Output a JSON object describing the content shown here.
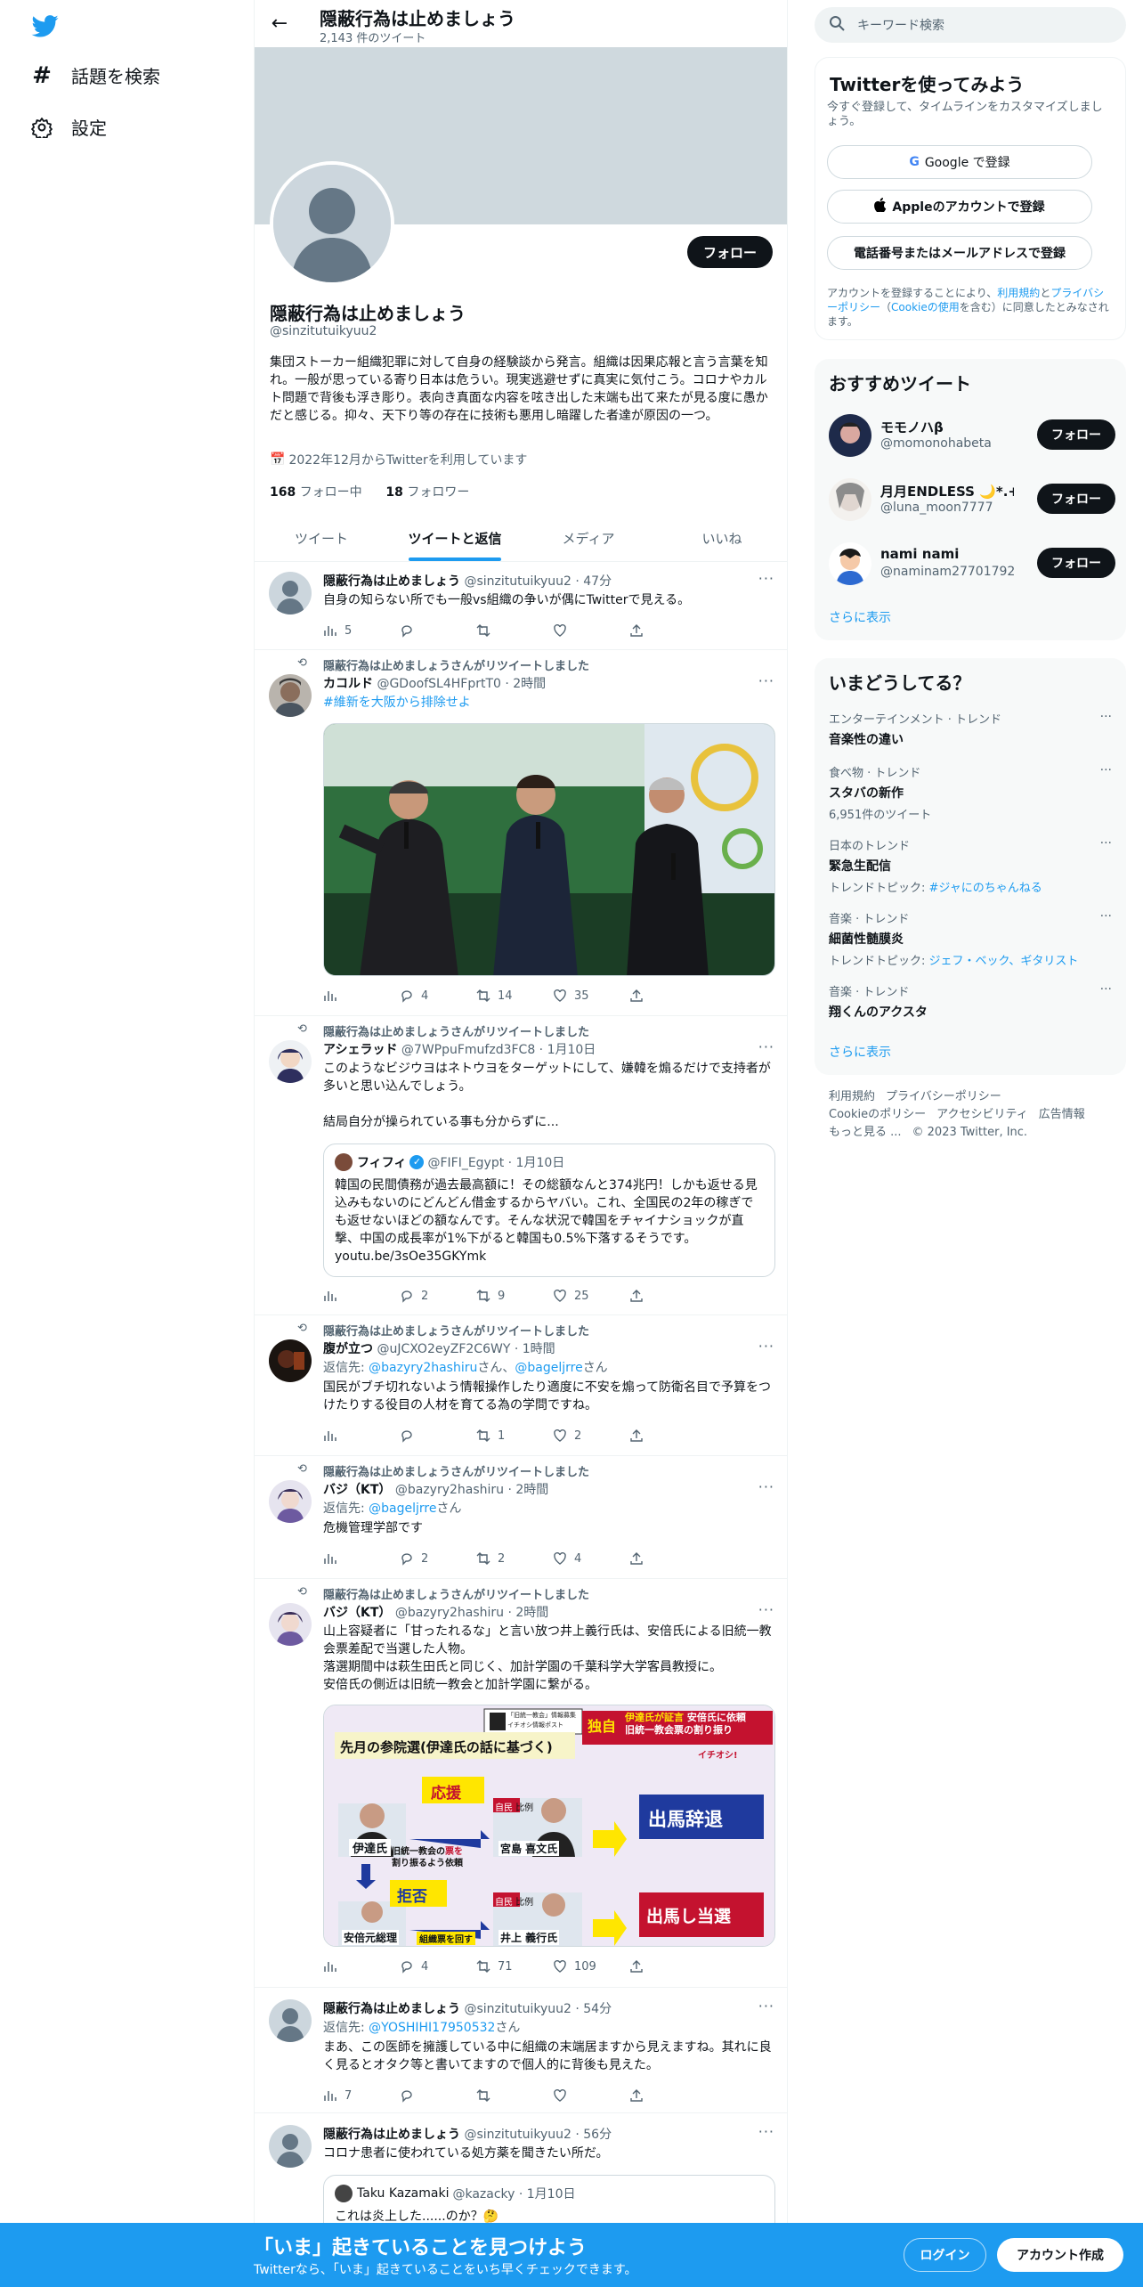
{
  "nav": {
    "explore": "話題を検索",
    "settings": "設定"
  },
  "header": {
    "name": "隠蔽行為は止めましょう",
    "tweet_count": "2,143 件のツイート"
  },
  "profile": {
    "follow_label": "フォロー",
    "name": "隠蔽行為は止めましょう",
    "handle": "@sinzitutuikyuu2",
    "bio": "集団ストーカー組織犯罪に対して自身の経験談から発言。組織は因果応報と言う言葉を知れ。一般が思っている寄り日本は危うい。現実逃避せずに真実に気付こう。コロナやカルト問題で背後も浮き彫り。表向き真面な内容を呟き出した末端も出て来たが見る度に愚かだと感じる。抑々、天下り等の存在に技術も悪用し暗躍した者達が原因の一つ。",
    "joined": "2022年12月からTwitterを利用しています",
    "following_count": "168",
    "following_label": "フォロー中",
    "followers_count": "18",
    "followers_label": "フォロワー"
  },
  "tabs": [
    "ツイート",
    "ツイートと返信",
    "メディア",
    "いいね"
  ],
  "tweets": [
    {
      "name": "隠蔽行為は止めましょう",
      "meta": "@sinzitutuikyuu2 · 47分",
      "text": "自身の知らない所でも一般vs組織の争いが偶にTwitterで見える。",
      "views": "5",
      "replies": "",
      "retweets": "",
      "likes": ""
    },
    {
      "rt": "隠蔽行為は止めましょうさんがリツイートしました",
      "name": "カコルド",
      "meta": "@GDoofSL4HFprtT0 · 2時間",
      "text": "#維新を大阪から排除せよ",
      "views": "",
      "replies": "4",
      "retweets": "14",
      "likes": "35"
    },
    {
      "rt": "隠蔽行為は止めましょうさんがリツイートしました",
      "name": "アシェラッド",
      "meta": "@7WPpuFmufzd3FC8 · 1月10日",
      "text": "このようなビジウヨはネトウヨをターゲットにして、嫌韓を煽るだけで支持者が多いと思い込んでしょう。\n\n結局自分が操られている事も分からずに...",
      "views": "",
      "replies": "2",
      "retweets": "9",
      "likes": "25",
      "quote": {
        "name": "フィフィ",
        "meta": "@FIFI_Egypt · 1月10日",
        "text": "韓国の民間債務が過去最高額に！その総額なんと374兆円！しかも返せる見込みもないのにどんどん借金するからヤバい。これ、全国民の2年の稼ぎでも返せないほどの額なんです。そんな状況で韓国をチャイナショックが直撃、中国の成長率が1%下がると韓国も0.5%下落するそうです。youtu.be/3sOe35GKYmk"
      }
    },
    {
      "rt": "隠蔽行為は止めましょうさんがリツイートしました",
      "name": "腹が立つ",
      "meta": "@uJCXO2eyZF2C6WY · 1時間",
      "reply_prefix": "返信先: ",
      "reply_to": "@bazyry2hashiru",
      "reply_mid": "さん、",
      "reply_to2": "@bageljrre",
      "reply_suffix": "さん",
      "text": "国民がブチ切れないよう情報操作したり適度に不安を煽って防衛名目で予算をつけたりする役目の人材を育てる為の学問ですね。",
      "views": "",
      "replies": "",
      "retweets": "1",
      "likes": "2"
    },
    {
      "rt": "隠蔽行為は止めましょうさんがリツイートしました",
      "name": "バジ（KT）",
      "meta": "@bazyry2hashiru · 2時間",
      "reply_prefix": "返信先: ",
      "reply_to": "@bageljrre",
      "reply_suffix": "さん",
      "text": "危機管理学部です",
      "views": "",
      "replies": "2",
      "retweets": "2",
      "likes": "4"
    },
    {
      "rt": "隠蔽行為は止めましょうさんがリツイートしました",
      "name": "バジ（KT）",
      "meta": "@bazyry2hashiru · 2時間",
      "text": "山上容疑者に「甘ったれるな」と言い放つ井上義行氏は、安倍氏による旧統一教会票差配で当選した人物。\n落選期間中は萩生田氏と同じく、加計学園の千葉科学大学客員教授に。\n安倍氏の側近は旧統一教会と加計学園に繋がる。",
      "views": "",
      "replies": "4",
      "retweets": "71",
      "likes": "109",
      "image": {
        "top_left": "「旧統一教会」情報募集",
        "top_left2": "イチオシ情報ポスト",
        "exclusive": "独自",
        "headline1": "伊達氏が証言",
        "headline1b": "安倍氏に依頼",
        "headline2": "旧統一教会票の割り振り",
        "brand": "イチオシ!",
        "title": "先月の参院選(伊達氏の話に基づく)",
        "p1": "伊達氏",
        "support": "応援",
        "party": "自民",
        "pr": "比例",
        "p2": "宮島 喜文氏",
        "out1": "出馬辞退",
        "req1": "旧統一教会の",
        "req1b": "票を",
        "req2": "割り振るよう依頼",
        "refuse": "拒否",
        "p3": "安倍元総理",
        "votes": "組織票を回す",
        "p4": "井上 義行氏",
        "out2": "出馬し当選"
      }
    },
    {
      "name": "隠蔽行為は止めましょう",
      "meta": "@sinzitutuikyuu2 · 54分",
      "reply_prefix": "返信先: ",
      "reply_to": "@YOSHIHI17950532",
      "reply_suffix": "さん",
      "text": "まあ、この医師を擁護している中に組織の末端居ますから見えますね。其れに良く見るとオタク等と書いてますので個人的に背後も見えた。",
      "views": "7",
      "replies": "",
      "retweets": "",
      "likes": ""
    },
    {
      "name": "隠蔽行為は止めましょう",
      "meta": "@sinzitutuikyuu2 · 56分",
      "text": "コロナ患者に使われている処方薬を聞きたい所だ。",
      "quote": {
        "name": "Taku Kazamaki",
        "meta": "@kazacky · 1月10日",
        "text": "これは炎上した......のか？🤔"
      }
    }
  ],
  "right": {
    "search_placeholder": "キーワード検索",
    "signup_title": "Twitterを使ってみよう",
    "signup_sub": "今すぐ登録して、タイムラインをカスタマイズしましょう。",
    "google_btn": "Google で登録",
    "apple_btn": "Appleのアカウントで登録",
    "phone_btn": "電話番号またはメールアドレスで登録",
    "terms_1": "アカウントを登録することにより、",
    "terms_link1": "利用規約",
    "terms_2": "と",
    "terms_link2": "プライバシーポリシー",
    "terms_3": "（",
    "terms_link3": "Cookieの使用",
    "terms_4": "を含む）に同意したとみなされます。",
    "rec_title": "おすすめツイート",
    "recs": [
      {
        "name": "モモノハβ",
        "handle": "@momonohabeta",
        "btn": "フォロー"
      },
      {
        "name": "月月ENDLESS 🌙*.+...",
        "handle": "@luna_moon7777",
        "btn": "フォロー"
      },
      {
        "name": "nami nami",
        "handle": "@naminam27701792",
        "btn": "フォロー"
      }
    ],
    "show_more": "さらに表示",
    "trend_title": "いまどうしてる？",
    "trends": [
      {
        "cat": "エンターテインメント · トレンド",
        "title": "音楽性の違い",
        "sub": ""
      },
      {
        "cat": "食べ物 · トレンド",
        "title": "スタバの新作",
        "sub": "6,951件のツイート"
      },
      {
        "cat": "日本のトレンド",
        "title": "緊急生配信",
        "sub_prefix": "トレンドトピック: ",
        "sub_link": "#ジャにのちゃんねる"
      },
      {
        "cat": "音楽 · トレンド",
        "title": "細菌性髄膜炎",
        "sub_prefix": "トレンドトピック: ",
        "sub_link": "ジェフ・ベック、ギタリスト"
      },
      {
        "cat": "音楽 · トレンド",
        "title": "翔くんのアクスタ",
        "sub": ""
      }
    ],
    "show_more2": "さらに表示",
    "footer": [
      "利用規約",
      "プライバシーポリシー",
      "Cookieのポリシー",
      "アクセシビリティ",
      "広告情報",
      "もっと見る ...",
      "© 2023 Twitter, Inc."
    ]
  },
  "bottom": {
    "title": "「いま」起きていることを見つけよう",
    "sub": "Twitterなら、「いま」起きていることをいち早くチェックできます。",
    "login": "ログイン",
    "signup": "アカウント作成"
  },
  "colors": {
    "accent": "#1d9bf0",
    "text": "#0f1419",
    "muted": "#536471"
  }
}
